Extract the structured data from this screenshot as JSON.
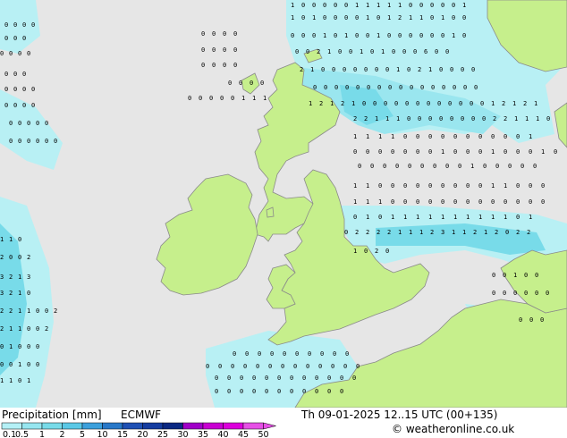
{
  "map": {
    "colors": {
      "sea": "#e6e6e6",
      "land": "#c6ef8c",
      "coast": "#8a8a8a",
      "rain_light": "#b8f0f4",
      "rain_medium": "#78dbe9"
    }
  },
  "legend": {
    "title": "Precipitation [mm]",
    "model": "ECMWF",
    "ticks": [
      "0.1",
      "0.5",
      "1",
      "2",
      "5",
      "10",
      "15",
      "20",
      "25",
      "30",
      "35",
      "40",
      "45",
      "50"
    ],
    "colors": [
      "#b4f0f6",
      "#96e6f0",
      "#78dbe9",
      "#5ac8e6",
      "#3ca0dc",
      "#2878c8",
      "#1e50b4",
      "#143ca0",
      "#0a2882",
      "#a000c8",
      "#c800d2",
      "#dc00dc",
      "#e650e6"
    ]
  },
  "valid_time": "Th 09-01-2025 12..15 UTC (00+135)",
  "credit": "© weatheronline.co.uk"
}
